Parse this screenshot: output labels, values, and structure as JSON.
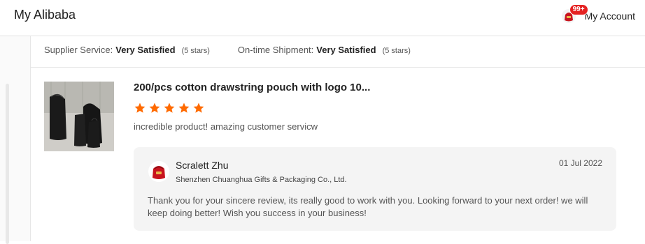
{
  "header": {
    "app_title": "My Alibaba",
    "notification_count": "99+",
    "account_label": "My Account"
  },
  "ratings": {
    "supplier_service_label": "Supplier Service:",
    "supplier_service_value": "Very Satisfied",
    "supplier_service_stars": "(5 stars)",
    "shipment_label": "On-time Shipment:",
    "shipment_value": "Very Satisfied",
    "shipment_stars": "(5 stars)"
  },
  "review": {
    "product_title": "200/pcs cotton drawstring pouch with logo 10...",
    "rating": 5,
    "star_color": "#ff6a00",
    "comment": "incredible product! amazing customer servicw"
  },
  "reply": {
    "name": "Scralett Zhu",
    "company": "Shenzhen Chuanghua Gifts & Packaging Co., Ltd.",
    "date": "01 Jul 2022",
    "text": "Thank you for your sincere review, its really good to work with you. Looking forward to your next order! we will keep doing better! Wish you success in your business!"
  },
  "colors": {
    "accent": "#ff6a00",
    "badge": "#e52222",
    "avatar_red": "#c8141e"
  }
}
